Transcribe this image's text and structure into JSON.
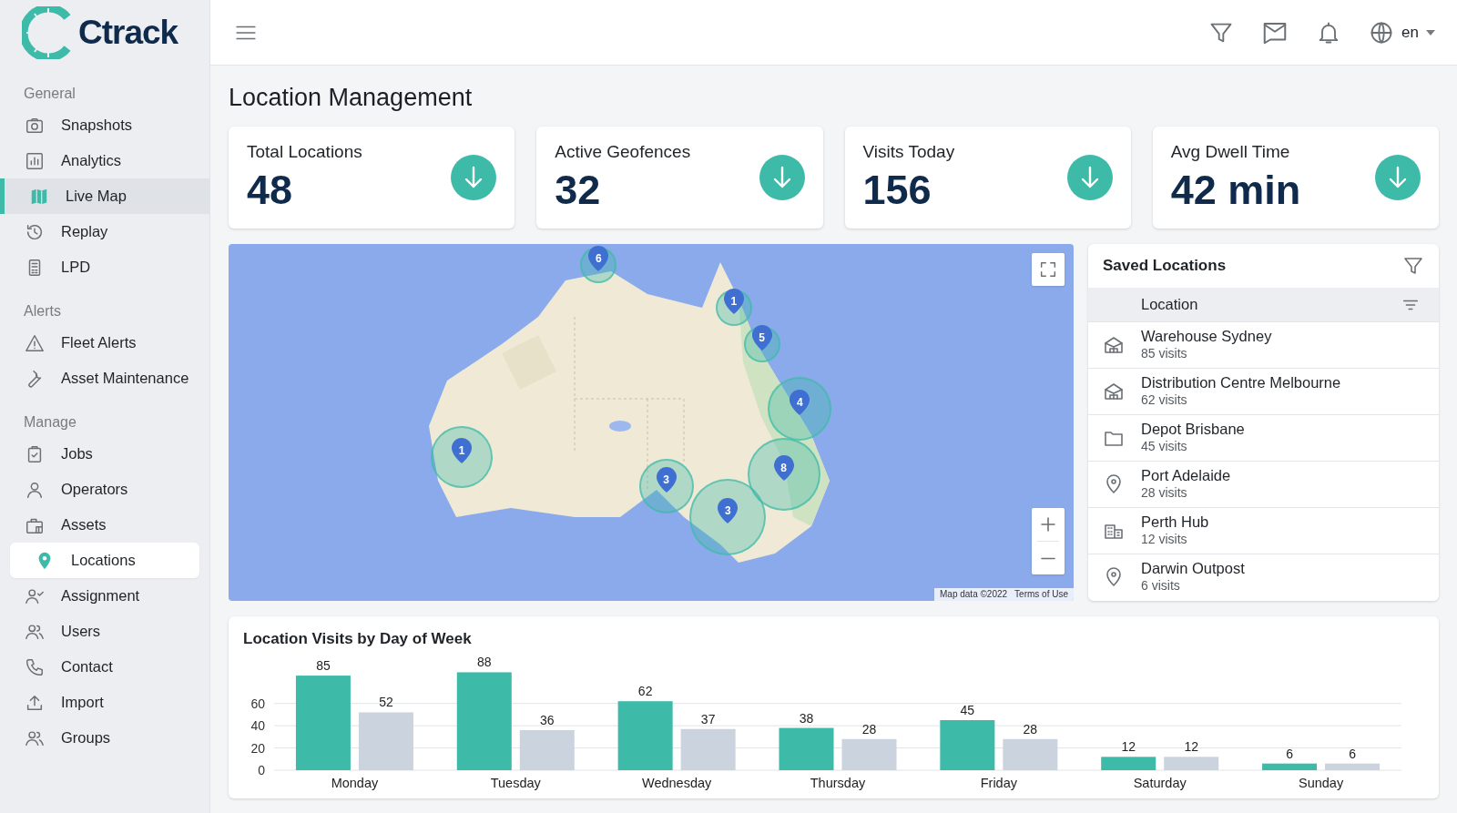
{
  "brand": {
    "name": "Ctrack"
  },
  "sidebar": {
    "sections": [
      {
        "label": "General",
        "items": [
          {
            "label": "Snapshots",
            "selected": false,
            "highlighted": false
          },
          {
            "label": "Analytics",
            "selected": false,
            "highlighted": false
          },
          {
            "label": "Live Map",
            "selected": false,
            "highlighted": true
          },
          {
            "label": "Replay",
            "selected": false,
            "highlighted": false
          },
          {
            "label": "LPD",
            "selected": false,
            "highlighted": false
          }
        ]
      },
      {
        "label": "Alerts",
        "items": [
          {
            "label": "Fleet Alerts",
            "selected": false,
            "highlighted": false
          },
          {
            "label": "Asset Maintenance",
            "selected": false,
            "highlighted": false
          }
        ]
      },
      {
        "label": "Manage",
        "items": [
          {
            "label": "Jobs",
            "selected": false,
            "highlighted": false
          },
          {
            "label": "Operators",
            "selected": false,
            "highlighted": false
          },
          {
            "label": "Assets",
            "selected": false,
            "highlighted": false
          },
          {
            "label": "Locations",
            "selected": true,
            "highlighted": false
          },
          {
            "label": "Assignment",
            "selected": false,
            "highlighted": false
          },
          {
            "label": "Users",
            "selected": false,
            "highlighted": false
          },
          {
            "label": "Contact",
            "selected": false,
            "highlighted": false
          },
          {
            "label": "Import",
            "selected": false,
            "highlighted": false
          },
          {
            "label": "Groups",
            "selected": false,
            "highlighted": false
          }
        ]
      }
    ]
  },
  "header": {
    "language": "en"
  },
  "page_title": "Location Management",
  "stats": [
    {
      "label": "Total Locations",
      "value": "48"
    },
    {
      "label": "Active Geofences",
      "value": "32"
    },
    {
      "label": "Visits Today",
      "value": "156"
    },
    {
      "label": "Avg Dwell Time",
      "value": "42 min"
    }
  ],
  "map": {
    "kind": "picture",
    "clusters": [
      {
        "count": "6"
      },
      {
        "count": "1"
      },
      {
        "count": "5"
      },
      {
        "count": "4"
      },
      {
        "count": "1"
      },
      {
        "count": "3"
      },
      {
        "count": "8"
      },
      {
        "count": "3"
      }
    ],
    "attribution": "Map data ©2022",
    "terms": "Terms of Use"
  },
  "saved_locations": {
    "title": "Saved Locations",
    "column": "Location",
    "rows": [
      {
        "name": "Warehouse Sydney",
        "visits": "85 visits"
      },
      {
        "name": "Distribution Centre Melbourne",
        "visits": "62 visits"
      },
      {
        "name": "Depot Brisbane",
        "visits": "45 visits"
      },
      {
        "name": "Port Adelaide",
        "visits": "28 visits"
      },
      {
        "name": "Perth Hub",
        "visits": "12 visits"
      },
      {
        "name": "Darwin Outpost",
        "visits": "6 visits"
      }
    ]
  },
  "visits_chart": {
    "chart_data": {
      "type": "bar",
      "title": "Location Visits by Day of Week",
      "categories": [
        "Monday",
        "Tuesday",
        "Wednesday",
        "Thursday",
        "Friday",
        "Saturday",
        "Sunday"
      ],
      "series": [
        {
          "color": "#3dbaa8",
          "values": [
            85,
            88,
            62,
            38,
            45,
            12,
            6
          ]
        },
        {
          "color": "#cbd3de",
          "values": [
            52,
            36,
            37,
            28,
            28,
            12,
            6
          ]
        }
      ],
      "ylim": [
        0,
        90
      ],
      "yticks": [
        0,
        20,
        40,
        60
      ],
      "grid": true,
      "data_labels": true
    }
  }
}
